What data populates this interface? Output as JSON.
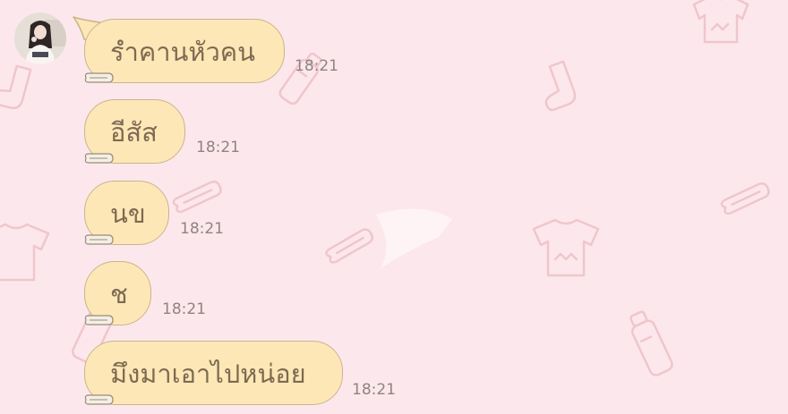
{
  "theme": {
    "background": "#fce8ec",
    "bubble_fill": "#fde7b6",
    "bubble_border": "#c9b48e",
    "bubble_text": "#7d6a52",
    "time_text": "#8e8480",
    "wallpaper_doodles": "#efc6cc"
  },
  "sender": {
    "avatar": "user-avatar-photo"
  },
  "messages": [
    {
      "text": "รำคานหัวคน",
      "time": "18:21"
    },
    {
      "text": "อีสัส",
      "time": "18:21"
    },
    {
      "text": "นข",
      "time": "18:21"
    },
    {
      "text": "ช",
      "time": "18:21"
    },
    {
      "text": "มึงมาเอาไปหน่อย",
      "time": "18:21"
    }
  ]
}
